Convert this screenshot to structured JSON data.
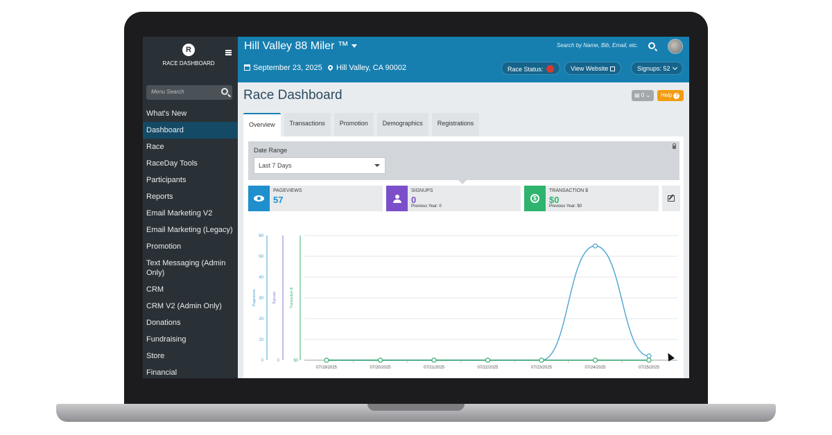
{
  "sidebar": {
    "logo_letter": "R",
    "logo_text": "RACE DASHBOARD",
    "search_placeholder": "Menu Search",
    "items": [
      {
        "label": "What's New"
      },
      {
        "label": "Dashboard",
        "active": true
      },
      {
        "label": "Race"
      },
      {
        "label": "RaceDay Tools"
      },
      {
        "label": "Participants"
      },
      {
        "label": "Reports"
      },
      {
        "label": "Email Marketing V2"
      },
      {
        "label": "Email Marketing (Legacy)"
      },
      {
        "label": "Promotion"
      },
      {
        "label": "Text Messaging (Admin Only)"
      },
      {
        "label": "CRM"
      },
      {
        "label": "CRM V2 (Admin Only)"
      },
      {
        "label": "Donations"
      },
      {
        "label": "Fundraising"
      },
      {
        "label": "Store"
      },
      {
        "label": "Financial"
      }
    ]
  },
  "header": {
    "race_title": "Hill Valley 88 Miler ™",
    "search_placeholder": "Search by Name, Bib, Email, etc.",
    "date": "September 23, 2025",
    "location": "Hill Valley, CA 90002",
    "race_status_label": "Race Status:",
    "view_website_label": "View Website",
    "signups_label": "Signups: 52"
  },
  "main": {
    "page_title": "Race Dashboard",
    "counter_value": "0",
    "help_label": "Help",
    "tabs": [
      {
        "label": "Overview",
        "active": true
      },
      {
        "label": "Transactions"
      },
      {
        "label": "Promotion"
      },
      {
        "label": "Demographics"
      },
      {
        "label": "Registrations"
      }
    ],
    "date_range": {
      "label": "Date Range",
      "selected": "Last 7 Days"
    },
    "stats": {
      "pageviews": {
        "label": "PAGEVIEWS",
        "value": "57",
        "color": "#1f8fce"
      },
      "signups": {
        "label": "SIGNUPS",
        "value": "0",
        "prev": "Previous Year: 0",
        "color": "#7b4fc9"
      },
      "transactions": {
        "label": "TRANSACTION $",
        "value": "$0",
        "prev": "Previous Year: $0",
        "color": "#2fb46e"
      }
    }
  },
  "colors": {
    "sidebar_bg": "#2a3136",
    "topbar_bg": "#167fb0",
    "active_nav": "#154a66",
    "status_red": "#d63a2f",
    "help_orange": "#f39c12"
  },
  "chart_data": {
    "type": "line",
    "x": [
      "07/19/2025",
      "07/20/2025",
      "07/21/2025",
      "07/22/2025",
      "07/23/2025",
      "07/24/2025",
      "07/25/2025"
    ],
    "series": [
      {
        "name": "Pageviews",
        "values": [
          0,
          0,
          0,
          0,
          0,
          55,
          2
        ],
        "color": "#4aa3d0"
      },
      {
        "name": "Signups",
        "values": [
          0,
          0,
          0,
          0,
          0,
          0,
          0
        ],
        "color": "#8a7bd1"
      },
      {
        "name": "Transaction $",
        "values": [
          0,
          0,
          0,
          0,
          0,
          0,
          0
        ],
        "color": "#3cb371"
      }
    ],
    "y_axes": [
      {
        "label": "Pageviews",
        "ticks": [
          "0",
          "10",
          "20",
          "30",
          "40",
          "50",
          "60"
        ],
        "ylim": [
          0,
          60
        ],
        "color": "#4aa3d0"
      },
      {
        "label": "Signups",
        "ticks": [
          "0"
        ],
        "color": "#8a7bd1"
      },
      {
        "label": "Transaction $",
        "ticks": [
          "$0"
        ],
        "color": "#3cb371"
      }
    ],
    "grid": true
  }
}
